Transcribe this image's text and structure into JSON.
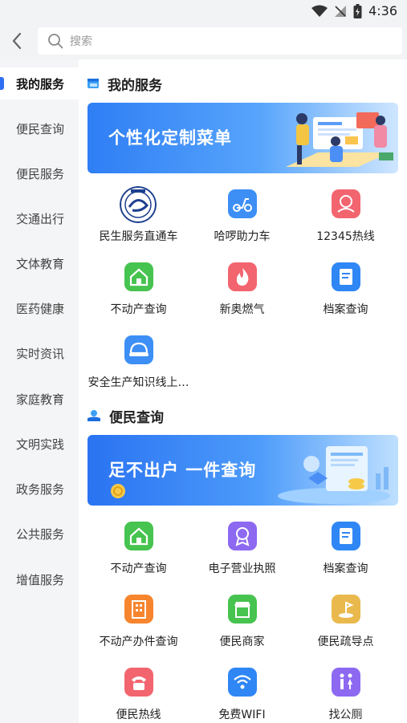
{
  "status_bar": {
    "time": "4:36"
  },
  "search": {
    "placeholder": "搜索"
  },
  "sidebar": {
    "items": [
      {
        "label": "我的服务"
      },
      {
        "label": "便民查询"
      },
      {
        "label": "便民服务"
      },
      {
        "label": "交通出行"
      },
      {
        "label": "文体教育"
      },
      {
        "label": "医药健康"
      },
      {
        "label": "实时资讯"
      },
      {
        "label": "家庭教育"
      },
      {
        "label": "文明实践"
      },
      {
        "label": "政务服务"
      },
      {
        "label": "公共服务"
      },
      {
        "label": "增值服务"
      }
    ]
  },
  "sections": [
    {
      "title": "我的服务",
      "banner_text": "个性化定制菜单",
      "items": [
        {
          "label": "民生服务直通车",
          "icon": "emblem-icon"
        },
        {
          "label": "哈啰助力车",
          "icon": "scooter-icon",
          "color": "#3d8ff5"
        },
        {
          "label": "12345热线",
          "icon": "user-hotline-icon",
          "color": "#f2656f"
        },
        {
          "label": "不动产查询",
          "icon": "house-icon",
          "color": "#47c34f"
        },
        {
          "label": "新奥燃气",
          "icon": "flame-icon",
          "color": "#f2656f"
        },
        {
          "label": "档案查询",
          "icon": "document-icon",
          "color": "#2f86f5"
        },
        {
          "label": "安全生产知识线上…",
          "icon": "helmet-icon",
          "color": "#3d8ff5"
        }
      ]
    },
    {
      "title": "便民查询",
      "banner_text": "足不出户  一件查询",
      "items": [
        {
          "label": "不动产查询",
          "icon": "house-icon",
          "color": "#47c34f"
        },
        {
          "label": "电子营业执照",
          "icon": "badge-icon",
          "color": "#8d69f1"
        },
        {
          "label": "档案查询",
          "icon": "document-icon",
          "color": "#2f86f5"
        },
        {
          "label": "不动产办件查询",
          "icon": "building-icon",
          "color": "#f7852d"
        },
        {
          "label": "便民商家",
          "icon": "store-icon",
          "color": "#47c34f"
        },
        {
          "label": "便民疏导点",
          "icon": "location-icon",
          "color": "#e9b94d"
        },
        {
          "label": "便民热线",
          "icon": "phone-icon",
          "color": "#f2656f"
        },
        {
          "label": "免费WIFI",
          "icon": "wifi-icon",
          "color": "#2f86f5"
        },
        {
          "label": "找公厕",
          "icon": "restroom-icon",
          "color": "#8d69f1"
        }
      ]
    }
  ]
}
